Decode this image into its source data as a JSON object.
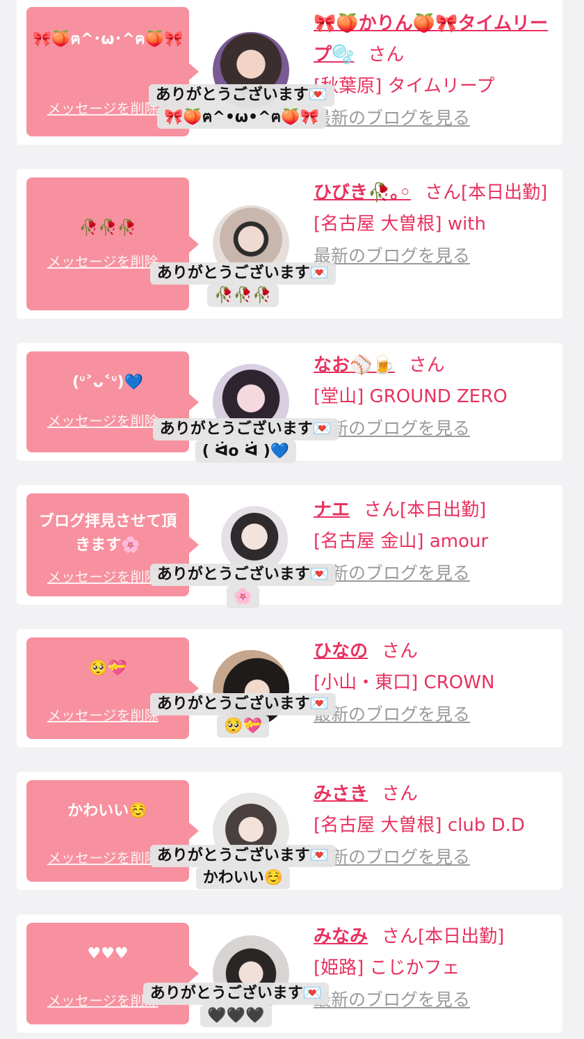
{
  "cards": [
    {
      "bubble": "🎀🍑ฅ^･ω･^ฅ🍑🎀",
      "delete_label": "メッセージを削除",
      "name": "🎀🍑かりん🍑🎀タイムリープ🫧",
      "san": "さん",
      "status": "",
      "shop": "[秋葉原] タイムリープ",
      "blog_label": "最新のブログを見る",
      "overlay_thanks": "ありがとうございます💌",
      "overlay_reply": "🎀🍑ฅ^•ω•^ฅ🍑🎀"
    },
    {
      "bubble": "🥀🥀🥀",
      "delete_label": "メッセージを削除",
      "name": "ひびき🥀｡◦",
      "san": "さん",
      "status": "[本日出勤]",
      "shop": "[名古屋 大曽根] with",
      "blog_label": "最新のブログを見る",
      "overlay_thanks": "ありがとうございます💌",
      "overlay_reply": "🥀🥀🥀"
    },
    {
      "bubble": "(ᐡ˃ᴗ˂ᐡ)💙",
      "delete_label": "メッセージを削除",
      "name": "なお⚾🍺",
      "san": "さん",
      "status": "",
      "shop": "[堂山] GROUND ZERO",
      "blog_label": "最新のブログを見る",
      "overlay_thanks": "ありがとうございます💌",
      "overlay_reply": "( ᐛo ᐛ )💙"
    },
    {
      "bubble": "ブログ拝見させて頂きます🌸",
      "delete_label": "メッセージを削除",
      "name": "ナエ",
      "san": "さん",
      "status": "[本日出勤]",
      "shop": "[名古屋 金山] amour",
      "blog_label": "最新のブログを見る",
      "overlay_thanks": "ありがとうございます💌",
      "overlay_reply": "🌸"
    },
    {
      "bubble": "🥺💝",
      "delete_label": "メッセージを削除",
      "name": "ひなの",
      "san": "さん",
      "status": "",
      "shop": "[小山・東口] CROWN",
      "blog_label": "最新のブログを見る",
      "overlay_thanks": "ありがとうございます💌",
      "overlay_reply": "🥺💝"
    },
    {
      "bubble": "かわいい☺️",
      "delete_label": "メッセージを削除",
      "name": "みさき",
      "san": "さん",
      "status": "",
      "shop": "[名古屋 大曽根] club D.D",
      "blog_label": "最新のブログを見る",
      "overlay_thanks": "ありがとうございます💌",
      "overlay_reply": "かわいい☺️"
    },
    {
      "bubble": "♥︎♥︎♥︎",
      "delete_label": "メッセージを削除",
      "name": "みなみ",
      "san": "さん",
      "status": "[本日出勤]",
      "shop": "[姫路] こじかフェ",
      "blog_label": "最新のブログを見る",
      "overlay_thanks": "ありがとうございます💌",
      "overlay_reply": "🖤🖤🖤"
    }
  ],
  "colors": {
    "bubble": "#f7919f",
    "name": "#e8315f",
    "blog_link": "#9a9a9a",
    "page_bg": "#f2f2f4"
  }
}
